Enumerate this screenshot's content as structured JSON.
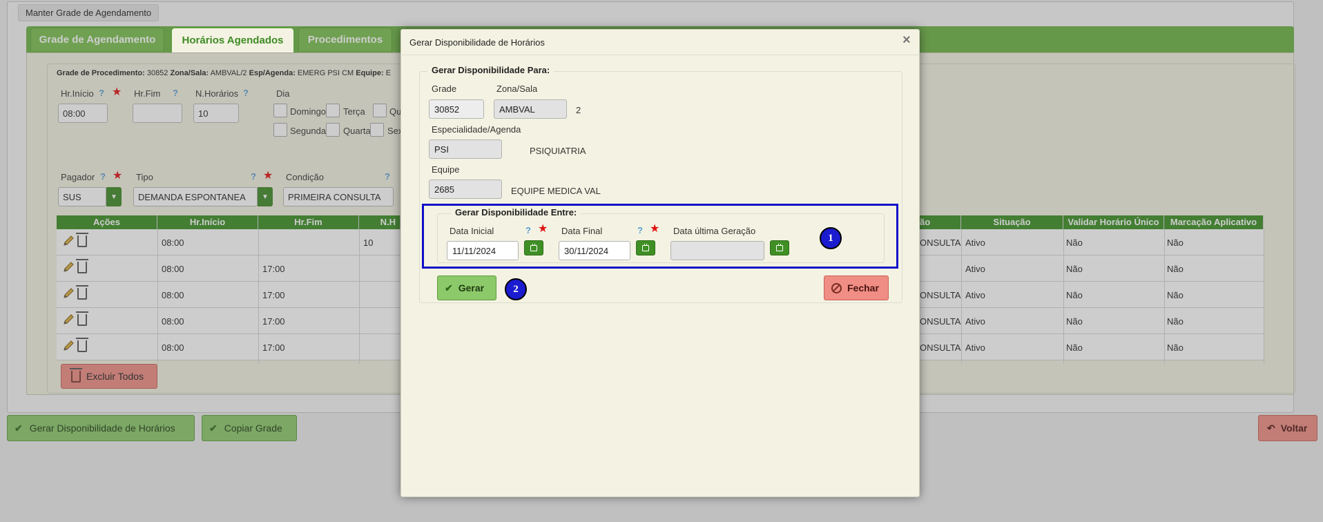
{
  "window_title": "Manter Grade de Agendamento",
  "tabs": [
    "Grade de Agendamento",
    "Horários Agendados",
    "Procedimentos"
  ],
  "info_line": {
    "grade_label": "Grade de Procedimento:",
    "grade_value": "30852",
    "zona_label": "Zona/Sala:",
    "zona_value": "AMBVAL/2",
    "esp_label": "Esp/Agenda:",
    "esp_value": "EMERG PSI CM",
    "equipe_label": "Equipe:",
    "equipe_value": "E"
  },
  "form": {
    "hr_inicio_label": "Hr.Início",
    "hr_inicio_value": "08:00",
    "hr_fim_label": "Hr.Fim",
    "hr_fim_value": "",
    "n_horarios_label": "N.Horários",
    "n_horarios_value": "10",
    "dia_label": "Dia",
    "days": [
      "Domingo",
      "Terça",
      "Qu",
      "Segunda",
      "Quarta",
      "Sex"
    ],
    "help_icon": "?",
    "pagador_label": "Pagador",
    "pagador_value": "SUS",
    "tipo_label": "Tipo",
    "tipo_value": "DEMANDA ESPONTANEA",
    "condicao_label": "Condição",
    "condicao_value": "PRIMEIRA CONSULTA"
  },
  "table": {
    "headers": [
      "Ações",
      "Hr.Início",
      "Hr.Fim",
      "N.H",
      "ão",
      "Situação",
      "Validar Horário Único",
      "Marcação Aplicativo"
    ],
    "rows": [
      {
        "inicio": "08:00",
        "fim": "",
        "n": "10",
        "tipo": "ONSULTA",
        "situacao": "Ativo",
        "validar": "Não",
        "marcacao": "Não"
      },
      {
        "inicio": "08:00",
        "fim": "17:00",
        "n": "",
        "tipo": "",
        "situacao": "Ativo",
        "validar": "Não",
        "marcacao": "Não"
      },
      {
        "inicio": "08:00",
        "fim": "17:00",
        "n": "",
        "tipo": "ONSULTA",
        "situacao": "Ativo",
        "validar": "Não",
        "marcacao": "Não"
      },
      {
        "inicio": "08:00",
        "fim": "17:00",
        "n": "",
        "tipo": "ONSULTA",
        "situacao": "Ativo",
        "validar": "Não",
        "marcacao": "Não"
      },
      {
        "inicio": "08:00",
        "fim": "17:00",
        "n": "",
        "tipo": "ONSULTA",
        "situacao": "Ativo",
        "validar": "Não",
        "marcacao": "Não"
      }
    ]
  },
  "buttons": {
    "excluir_todos": "Excluir Todos",
    "gerar_disponibilidade": "Gerar Disponibilidade de Horários",
    "copiar_grade": "Copiar Grade",
    "voltar": "Voltar"
  },
  "modal": {
    "title": "Gerar Disponibilidade de Horários",
    "close_icon": "×",
    "fieldset_para": "Gerar Disponibilidade Para:",
    "grade_label": "Grade",
    "grade_value": "30852",
    "zona_label": "Zona/Sala",
    "zona_value": "AMBVAL",
    "zona_suffix": "2",
    "especialidade_label": "Especialidade/Agenda",
    "especialidade_value": "PSI",
    "especialidade_desc": "PSIQUIATRIA",
    "equipe_label": "Equipe",
    "equipe_value": "2685",
    "equipe_desc": "EQUIPE MEDICA VAL",
    "fieldset_entre": "Gerar Disponibilidade Entre:",
    "data_inicial_label": "Data Inicial",
    "data_inicial_value": "11/11/2024",
    "data_final_label": "Data Final",
    "data_final_value": "30/11/2024",
    "data_ultima_label": "Data última Geração",
    "data_ultima_value": "",
    "gerar_button": "Gerar",
    "fechar_button": "Fechar",
    "badge_1": "1",
    "badge_2": "2"
  },
  "colors": {
    "brand_green": "#7ac04f",
    "header_green": "#3a8f23",
    "danger_red": "#f08d84",
    "highlight_blue": "#1010c8"
  }
}
